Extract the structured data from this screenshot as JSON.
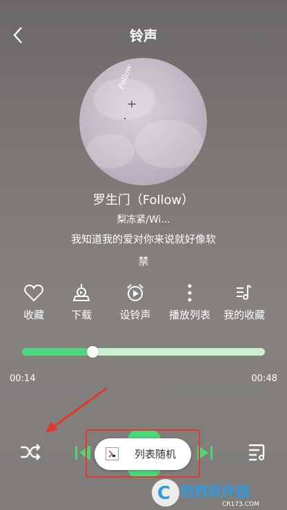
{
  "header": {
    "title": "铃声"
  },
  "song": {
    "title": "罗生门（Follow）",
    "artist": "梨冻紧/Wi...",
    "lyric_line1": "我知道我的爱对你来说就好像软",
    "lyric_line2": "禁",
    "cover_text": "Follow"
  },
  "actions": [
    {
      "label": "收藏",
      "icon": "heart-icon"
    },
    {
      "label": "下载",
      "icon": "download-icon"
    },
    {
      "label": "设铃声",
      "icon": "alarm-icon"
    },
    {
      "label": "播放列表",
      "icon": "more-vertical-icon"
    },
    {
      "label": "我的收藏",
      "icon": "music-list-icon"
    }
  ],
  "progress": {
    "current": "00:14",
    "total": "00:48",
    "fraction": 0.29
  },
  "controls": {
    "shuffle_icon": "shuffle-icon",
    "prev_icon": "previous-icon",
    "next_icon": "next-icon",
    "playlist_icon": "playlist-icon"
  },
  "popup": {
    "label": "列表随机"
  },
  "watermark": {
    "text": "西西软件园",
    "sub": "CR173.COM"
  },
  "colors": {
    "accent": "#4cd77a",
    "highlight": "#e0382b"
  }
}
